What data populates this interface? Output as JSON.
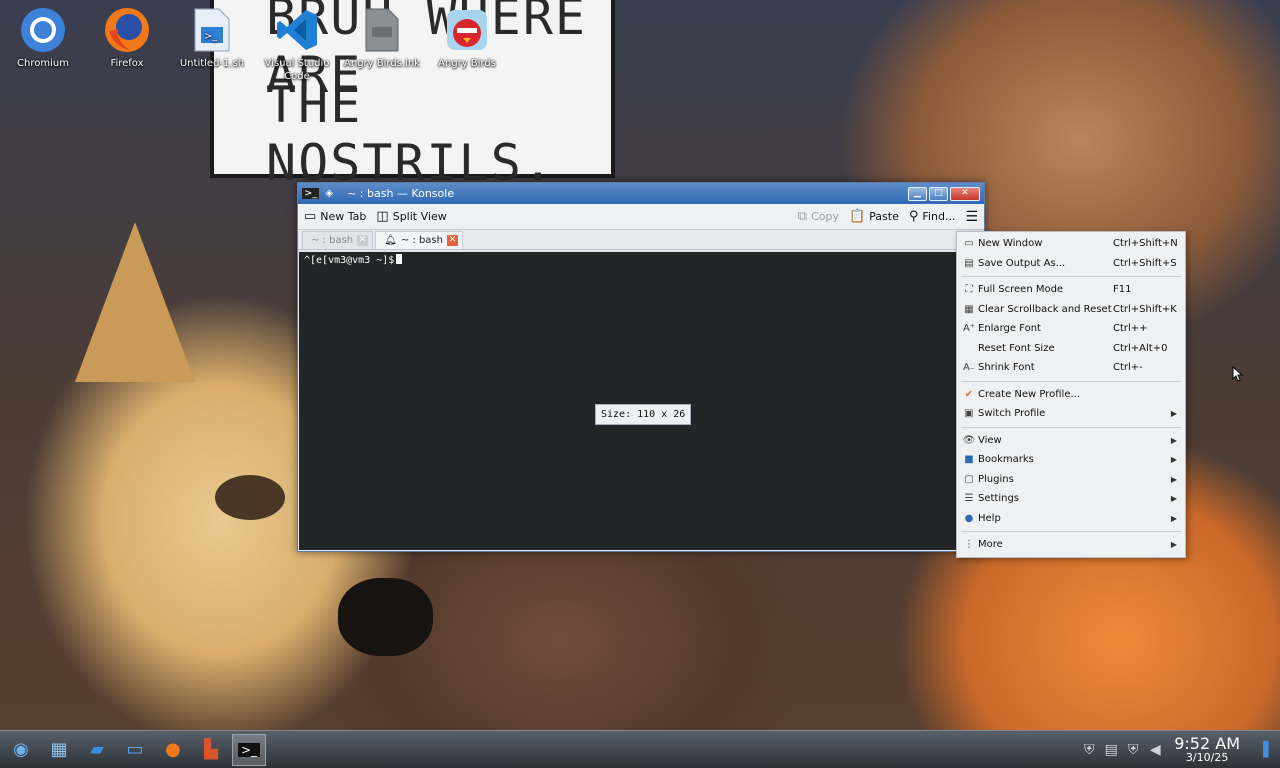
{
  "desktop": {
    "icons": [
      {
        "label": "Chromium",
        "icon": "chromium-icon"
      },
      {
        "label": "Firefox",
        "icon": "firefox-icon"
      },
      {
        "label": "Untitled-1.sh",
        "icon": "script-file-icon"
      },
      {
        "label": "Visual Studio Code",
        "icon": "vscode-icon"
      },
      {
        "label": "Angry Birds.lnk",
        "icon": "shortcut-file-icon"
      },
      {
        "label": "Angry Birds",
        "icon": "angry-birds-icon"
      }
    ],
    "wallpaper_text_1": "BRUH WHERE ARE",
    "wallpaper_text_2": "THE NOSTRILS."
  },
  "window": {
    "title": "~ : bash — Konsole",
    "toolbar": {
      "new_tab": "New Tab",
      "split_view": "Split View",
      "copy": "Copy",
      "paste": "Paste",
      "find": "Find..."
    },
    "tabs": [
      {
        "label": "~ : bash",
        "active": false
      },
      {
        "label": "~ : bash",
        "active": true
      }
    ],
    "terminal": {
      "prompt": "^[e[vm3@vm3 ~]$",
      "size_tooltip": "Size: 110 x 26"
    }
  },
  "menu": {
    "items": [
      {
        "label": "New Window",
        "shortcut": "Ctrl+Shift+N",
        "icon": "new-window-icon"
      },
      {
        "label": "Save Output As...",
        "shortcut": "Ctrl+Shift+S",
        "icon": "save-icon"
      },
      {
        "label": "Full Screen Mode",
        "shortcut": "F11",
        "icon": "fullscreen-icon"
      },
      {
        "label": "Clear Scrollback and Reset",
        "shortcut": "Ctrl+Shift+K",
        "icon": "clear-icon"
      },
      {
        "label": "Enlarge Font",
        "shortcut": "Ctrl++",
        "icon": "font-larger-icon"
      },
      {
        "label": "Reset Font Size",
        "shortcut": "Ctrl+Alt+0",
        "icon": ""
      },
      {
        "label": "Shrink Font",
        "shortcut": "Ctrl+-",
        "icon": "font-smaller-icon"
      },
      {
        "label": "Create New Profile...",
        "shortcut": "",
        "icon": "check-icon"
      },
      {
        "label": "Switch Profile",
        "shortcut": "",
        "icon": "profile-icon",
        "submenu": true
      },
      {
        "label": "View",
        "shortcut": "",
        "icon": "eye-icon",
        "submenu": true
      },
      {
        "label": "Bookmarks",
        "shortcut": "",
        "icon": "bookmark-icon",
        "submenu": true
      },
      {
        "label": "Plugins",
        "shortcut": "",
        "icon": "plugin-icon",
        "submenu": true
      },
      {
        "label": "Settings",
        "shortcut": "",
        "icon": "settings-icon",
        "submenu": true
      },
      {
        "label": "Help",
        "shortcut": "",
        "icon": "help-icon",
        "submenu": true
      },
      {
        "label": "More",
        "shortcut": "",
        "icon": "more-icon",
        "submenu": true
      }
    ]
  },
  "taskbar": {
    "apps": [
      "start-icon",
      "desktop-icon",
      "explorer-icon",
      "window-icon",
      "firefox-icon",
      "powerpoint-icon",
      "terminal-icon"
    ],
    "time": "9:52 AM",
    "date": "3/10/25"
  }
}
